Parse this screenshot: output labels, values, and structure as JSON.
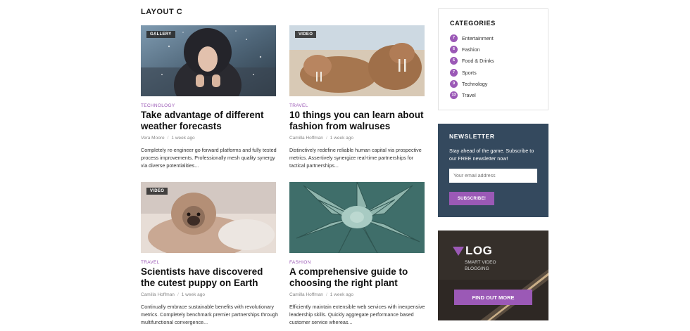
{
  "section_title": "LAYOUT C",
  "articles": [
    {
      "tag": "GALLERY",
      "category": "TECHNOLOGY",
      "title": "Take advantage of different weather forecasts",
      "author": "Vera Moore",
      "time": "1 week ago",
      "excerpt": "Completely re-engineer go forward platforms and fully tested process improvements. Professionally mesh quality synergy via diverse potentialities..."
    },
    {
      "tag": "VIDEO",
      "category": "TRAVEL",
      "title": "10 things you can learn about fashion from walruses",
      "author": "Camilla Hoffman",
      "time": "1 week ago",
      "excerpt": "Distinctively redefine reliable human capital via prospective metrics. Assertively synergize real-time partnerships for tactical partnerships..."
    },
    {
      "tag": "VIDEO",
      "category": "TRAVEL",
      "title": "Scientists have discovered the cutest puppy on Earth",
      "author": "Camilla Hoffman",
      "time": "1 week ago",
      "excerpt": "Continually embrace sustainable benefits with revolutionary metrics. Completely benchmark premier partnerships through multifunctional convergence..."
    },
    {
      "tag": "",
      "category": "FASHION",
      "title": "A comprehensive guide to choosing the right plant",
      "author": "Camilla Hoffman",
      "time": "1 week ago",
      "excerpt": "Efficiently maintain extensible web services with inexpensive leadership skills. Quickly aggregate performance based customer service whereas..."
    }
  ],
  "categories": {
    "title": "CATEGORIES",
    "items": [
      {
        "count": "7",
        "label": "Entertainment"
      },
      {
        "count": "6",
        "label": "Fashion"
      },
      {
        "count": "6",
        "label": "Food & Drinks"
      },
      {
        "count": "7",
        "label": "Sports"
      },
      {
        "count": "9",
        "label": "Technology"
      },
      {
        "count": "13",
        "label": "Travel"
      }
    ]
  },
  "newsletter": {
    "title": "NEWSLETTER",
    "description": "Stay ahead of the game. Subscribe to our FREE newsletter now!",
    "placeholder": "Your email address",
    "button": "SUBSCRIBE!"
  },
  "ad": {
    "logo": "LOG",
    "tagline": "SMART VIDEO BLOGGING",
    "button": "FIND OUT MORE"
  },
  "colors": {
    "accent": "#9b59b6",
    "newsletter_bg": "#34495e"
  }
}
